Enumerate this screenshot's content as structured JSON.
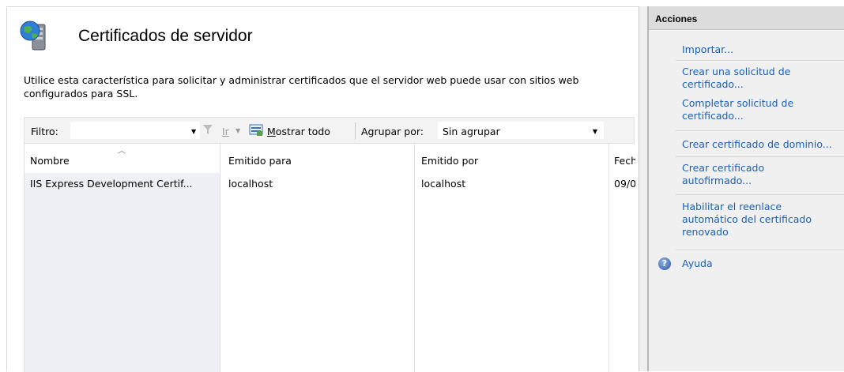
{
  "feature": {
    "title": "Certificados de servidor",
    "description": "Utilice esta característica para solicitar y administrar certificados que el servidor web puede usar con sitios web configurados para SSL.",
    "icon": "server-globe-icon"
  },
  "toolbar": {
    "filter_label": "Filtro:",
    "filter_value": "",
    "go_label": "Ir",
    "show_all_label_prefix": "",
    "show_all_label_underlined": "M",
    "show_all_label_rest": "ostrar todo",
    "group_by_label": "Agrupar por:",
    "group_by_value": "Sin agrupar"
  },
  "grid": {
    "columns": [
      "Nombre",
      "Emitido para",
      "Emitido por",
      "Fech"
    ],
    "rows": [
      {
        "name": "IIS Express Development Certif...",
        "issued_to": "localhost",
        "issued_by": "localhost",
        "date": "09/0"
      }
    ]
  },
  "actions": {
    "title": "Acciones",
    "items": [
      {
        "label": "Importar..."
      },
      {
        "label": "Crear una solicitud de certificado..."
      },
      {
        "label": "Completar solicitud de certificado..."
      },
      {
        "label": "Crear certificado de dominio..."
      },
      {
        "label": "Crear certificado autofirmado..."
      },
      {
        "label": "Habilitar el reenlace automático del certificado renovado"
      }
    ],
    "help_label": "Ayuda"
  },
  "colors": {
    "link": "#1b5fb3",
    "actions_panel_bg": "#f0f0f0",
    "actions_header_bg": "#dcdcdc",
    "selection_band": "#eef0f5"
  }
}
